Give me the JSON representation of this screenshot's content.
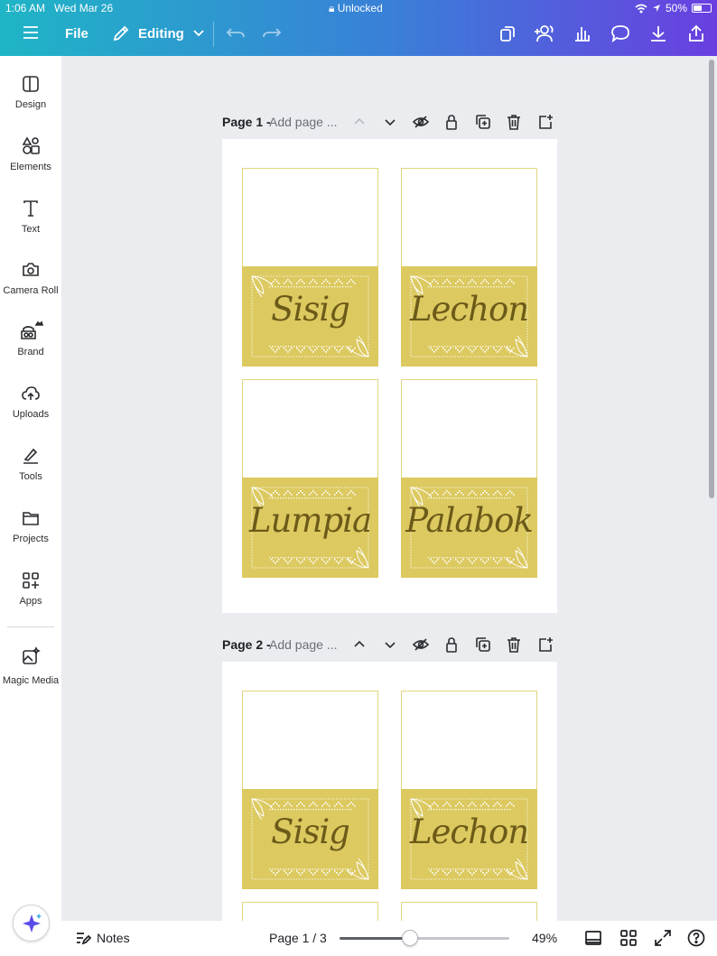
{
  "status_bar": {
    "time": "1:06 AM",
    "date": "Wed Mar 26",
    "center": "Unlocked",
    "battery": "50%"
  },
  "toolbar": {
    "file_label": "File",
    "mode_label": "Editing"
  },
  "sidebar": {
    "items": [
      {
        "label": "Design",
        "icon": "layout-icon"
      },
      {
        "label": "Elements",
        "icon": "shapes-icon"
      },
      {
        "label": "Text",
        "icon": "text-icon"
      },
      {
        "label": "Camera Roll",
        "icon": "camera-icon"
      },
      {
        "label": "Brand",
        "icon": "brand-icon"
      },
      {
        "label": "Uploads",
        "icon": "cloud-upload-icon"
      },
      {
        "label": "Tools",
        "icon": "pen-icon"
      },
      {
        "label": "Projects",
        "icon": "folder-icon"
      },
      {
        "label": "Apps",
        "icon": "apps-icon"
      },
      {
        "label": "Magic Media",
        "icon": "magic-media-icon"
      }
    ]
  },
  "pages": [
    {
      "title": "Page 1 -",
      "placeholder": "Add page ...",
      "cards": [
        "Sisig",
        "Lechon",
        "Lumpia",
        "Palabok"
      ]
    },
    {
      "title": "Page 2 -",
      "placeholder": "Add page ...",
      "cards": [
        "Sisig",
        "Lechon"
      ]
    }
  ],
  "bottom_bar": {
    "notes_label": "Notes",
    "page_indicator": "Page 1 / 3",
    "zoom": "49%"
  },
  "colors": {
    "card_gold": "#dcc960",
    "card_text": "#6b5a18",
    "brand_gradient_start": "#1fb5c6",
    "brand_gradient_end": "#6a3fe0"
  }
}
